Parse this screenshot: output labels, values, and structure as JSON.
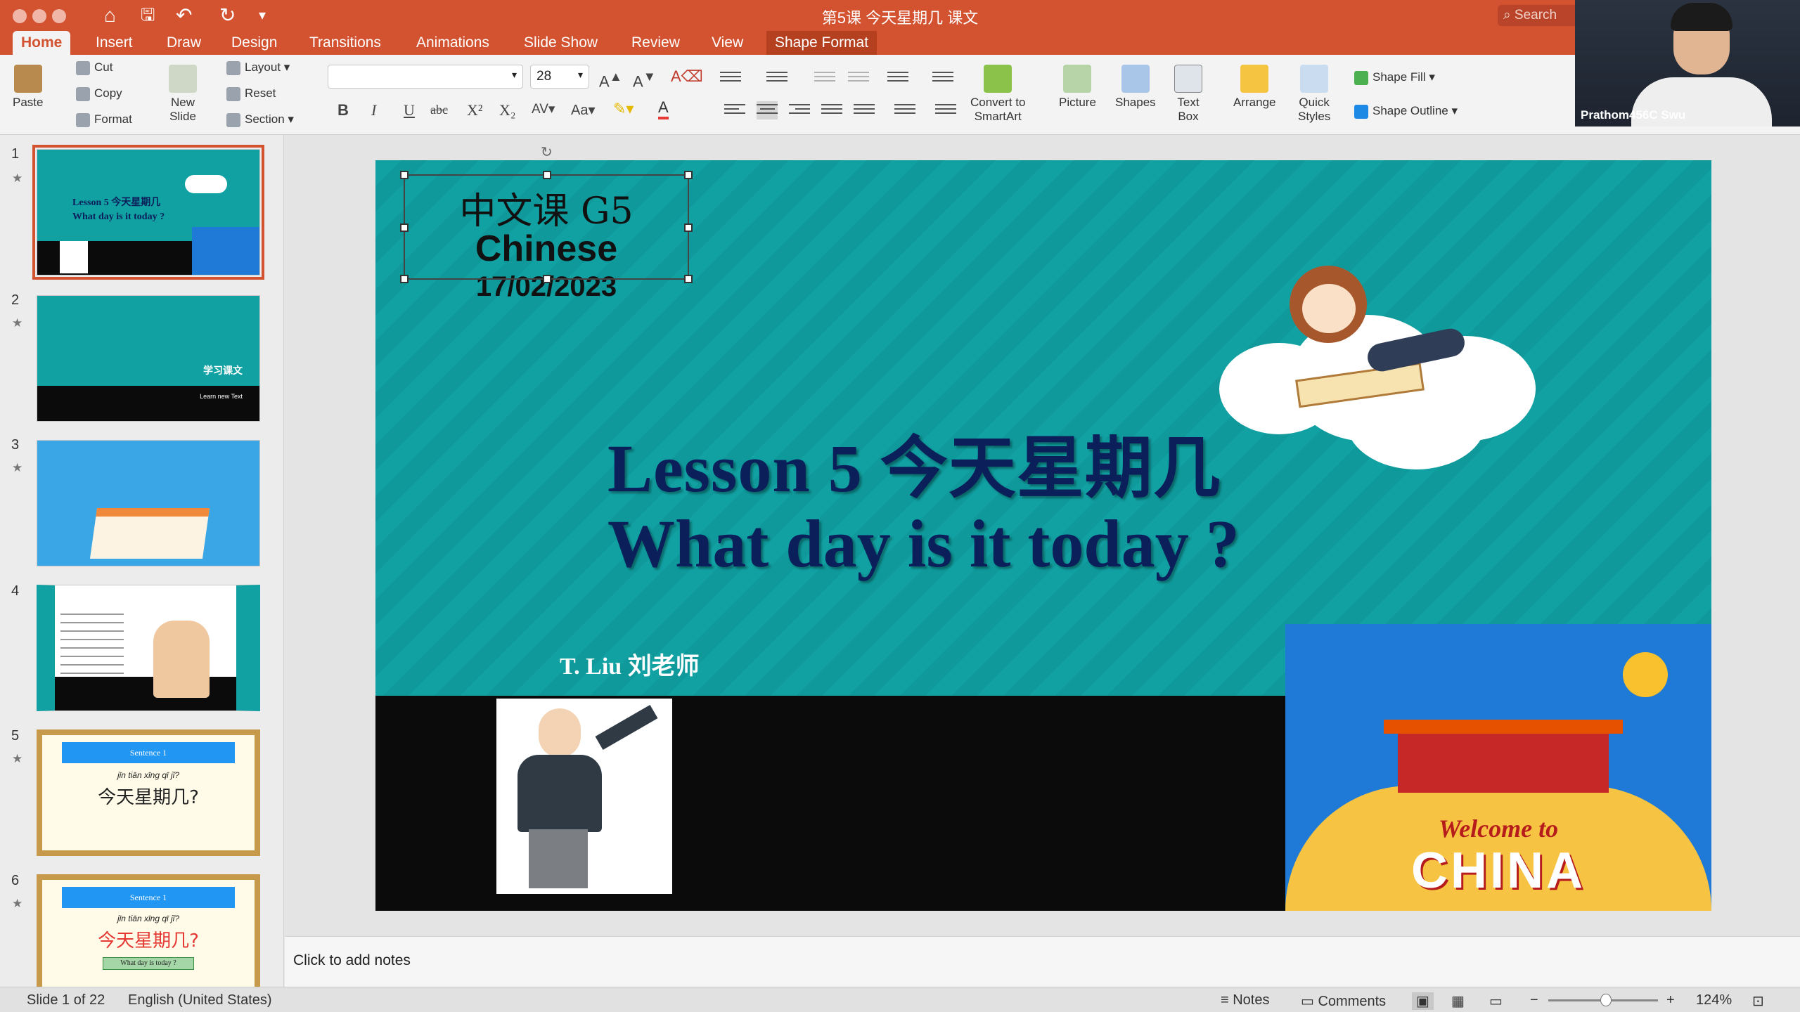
{
  "window": {
    "title": "第5课 今天星期几 课文",
    "search_placeholder": "Search"
  },
  "tabs": [
    "Home",
    "Insert",
    "Draw",
    "Design",
    "Transitions",
    "Animations",
    "Slide Show",
    "Review",
    "View",
    "Shape Format"
  ],
  "ribbon": {
    "paste": "Paste",
    "cut": "Cut",
    "copy": "Copy",
    "format": "Format",
    "new_slide_1": "New",
    "new_slide_2": "Slide",
    "layout": "Layout",
    "reset": "Reset",
    "section": "Section",
    "font_size": "28",
    "convert_1": "Convert to",
    "convert_2": "SmartArt",
    "picture": "Picture",
    "shapes": "Shapes",
    "textbox_1": "Text",
    "textbox_2": "Box",
    "arrange": "Arrange",
    "quick_styles_1": "Quick",
    "quick_styles_2": "Styles",
    "shape_fill": "Shape Fill",
    "shape_outline": "Shape Outline"
  },
  "webcam": {
    "name": "Prathom456C Swu"
  },
  "thumbnails": [
    {
      "num": "1"
    },
    {
      "num": "2",
      "title": "学习课文",
      "subtitle": "Learn new Text"
    },
    {
      "num": "3"
    },
    {
      "num": "4"
    },
    {
      "num": "5",
      "banner": "Sentence 1",
      "pinyin": "jīn tiān xīng qī jǐ?",
      "hanzi": "今天星期几?"
    },
    {
      "num": "6",
      "banner": "Sentence 1",
      "pinyin": "jīn tiān xīng qī jǐ?",
      "hanzi": "今天星期几?",
      "english": "What day is today ?"
    }
  ],
  "slide": {
    "textbox_line1": "中文课 G5",
    "textbox_line2": "Chinese",
    "date": "17/02/2023",
    "title_line1": "Lesson 5 今天星期几",
    "title_line2": "What day is it today ?",
    "teacher": "T. Liu 刘老师",
    "welcome": "Welcome to",
    "china": "CHINA"
  },
  "notes_placeholder": "Click to add notes",
  "status": {
    "slide_info": "Slide 1 of 22",
    "language": "English (United States)",
    "notes": "Notes",
    "comments": "Comments",
    "zoom": "124%"
  },
  "colors": {
    "accent": "#d35230",
    "slide_teal": "#12a1a3",
    "title_navy": "#0b1f5a"
  }
}
